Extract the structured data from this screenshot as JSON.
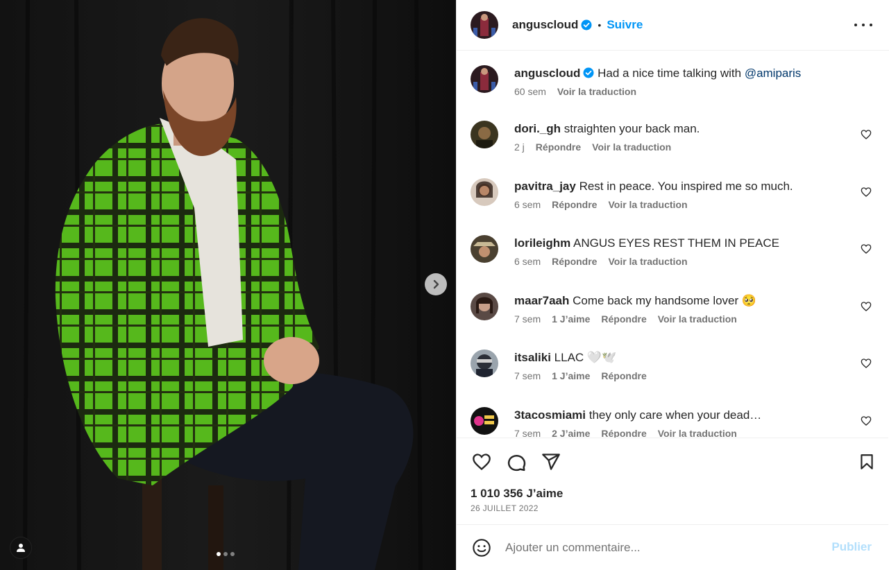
{
  "post": {
    "author": "anguscloud",
    "follow_label": "Suivre",
    "separator": "•",
    "caption_text": "Had a nice time talking with",
    "caption_mention": "@amiparis",
    "caption_time": "60 sem",
    "translate_label": "Voir la traduction",
    "likes": "1 010 356 J’aime",
    "date": "26 JUILLET 2022",
    "comment_placeholder": "Ajouter un commentaire...",
    "publish_label": "Publier"
  },
  "comments": [
    {
      "user": "dori._gh",
      "text": "straighten your back man.",
      "time": "2 j",
      "likes": "",
      "reply": "Répondre",
      "translate": "Voir la traduction"
    },
    {
      "user": "pavitra_jay",
      "text": "Rest in peace. You inspired me so much.",
      "time": "6 sem",
      "likes": "",
      "reply": "Répondre",
      "translate": "Voir la traduction"
    },
    {
      "user": "lorileighm",
      "text": "ANGUS EYES REST THEM IN PEACE",
      "time": "6 sem",
      "likes": "",
      "reply": "Répondre",
      "translate": "Voir la traduction"
    },
    {
      "user": "maar7aah",
      "text": "Come back my handsome lover 🥺",
      "time": "7 sem",
      "likes": "1 J’aime",
      "reply": "Répondre",
      "translate": "Voir la traduction"
    },
    {
      "user": "itsaliki",
      "text": "LLAC 🤍🕊️",
      "time": "7 sem",
      "likes": "1 J’aime",
      "reply": "Répondre",
      "translate": ""
    },
    {
      "user": "3tacosmiami",
      "text": "they only care when your dead…",
      "time": "7 sem",
      "likes": "2 J’aime",
      "reply": "Répondre",
      "translate": "Voir la traduction"
    }
  ],
  "carousel": {
    "slides": 3,
    "active": 1
  },
  "colors": {
    "accent": "#0095f6",
    "jacket_green": "#5fc21f",
    "muted": "#737373"
  }
}
